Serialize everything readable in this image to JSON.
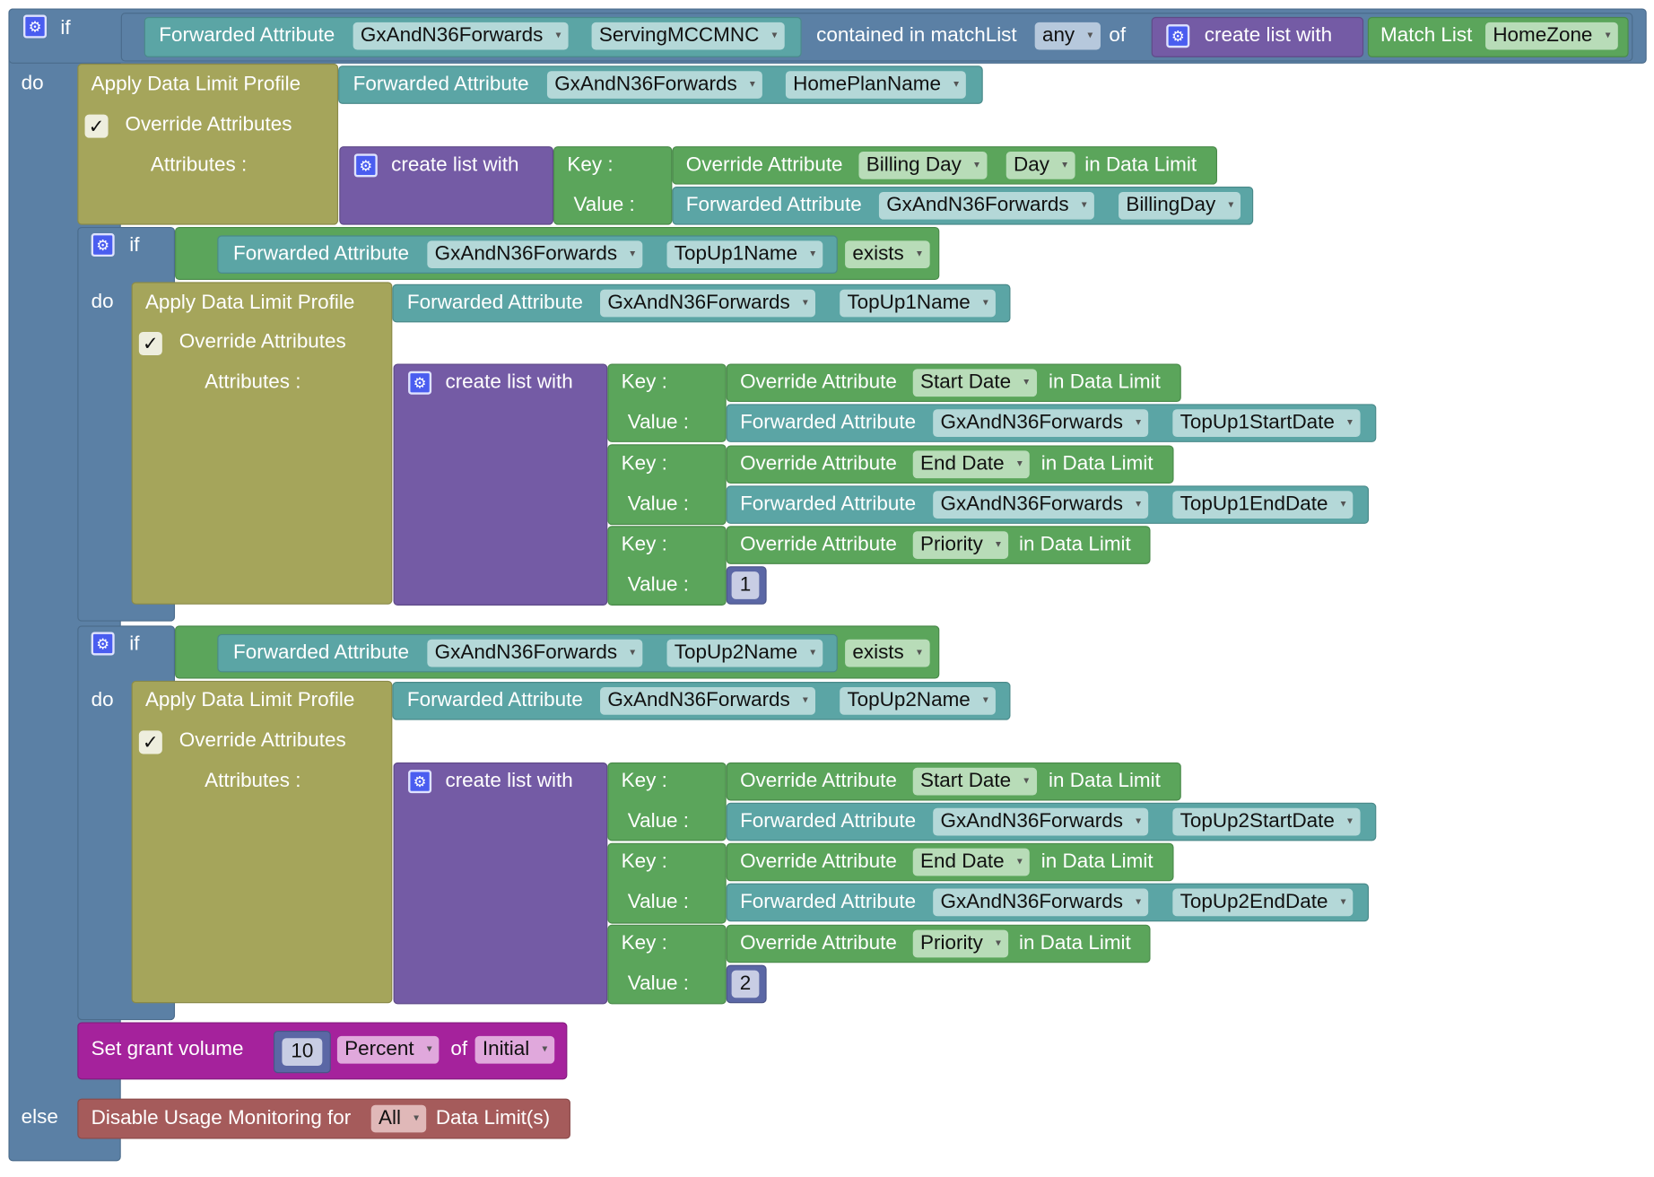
{
  "keywords": {
    "if": "if",
    "do": "do",
    "else": "else",
    "of": "of",
    "key": "Key :",
    "value": "Value :",
    "attributes": "Attributes :"
  },
  "icons": {
    "gear": "⚙",
    "check": "✓",
    "caret": "▾"
  },
  "colors": {
    "logic": "#5b80a5",
    "profile": "#a5a55b",
    "list": "#745ba5",
    "override": "#5ba55b",
    "forwarded": "#5ba5a5",
    "grant": "#a5229c",
    "disable": "#a55b5b"
  },
  "top_condition": {
    "label": "Forwarded Attribute",
    "source": "GxAndN36Forwards",
    "attr": "ServingMCCMNC",
    "contained_label": "contained in matchList",
    "mode": "any",
    "of_label": "of",
    "list_label": "create list with",
    "matchlist_label": "Match List",
    "matchlist_value": "HomeZone"
  },
  "profile_main": {
    "title": "Apply Data Limit Profile",
    "override_label": "Override Attributes",
    "profile_ref": {
      "label": "Forwarded Attribute",
      "source": "GxAndN36Forwards",
      "attr": "HomePlanName"
    },
    "list_label": "create list with",
    "pairs": [
      {
        "key": {
          "label": "Override Attribute",
          "attr": "Billing Day",
          "unit": "Day",
          "suffix": "in Data Limit"
        },
        "value": {
          "label": "Forwarded Attribute",
          "source": "GxAndN36Forwards",
          "attr": "BillingDay"
        }
      }
    ]
  },
  "topup1": {
    "cond": {
      "label": "Forwarded Attribute",
      "source": "GxAndN36Forwards",
      "attr": "TopUp1Name",
      "op": "exists"
    },
    "title": "Apply Data Limit Profile",
    "override_label": "Override Attributes",
    "profile_ref": {
      "label": "Forwarded Attribute",
      "source": "GxAndN36Forwards",
      "attr": "TopUp1Name"
    },
    "list_label": "create list with",
    "pairs": [
      {
        "key": {
          "label": "Override Attribute",
          "attr": "Start Date",
          "suffix": "in Data Limit"
        },
        "value": {
          "label": "Forwarded Attribute",
          "source": "GxAndN36Forwards",
          "attr": "TopUp1StartDate"
        }
      },
      {
        "key": {
          "label": "Override Attribute",
          "attr": "End Date",
          "suffix": "in Data Limit"
        },
        "value": {
          "label": "Forwarded Attribute",
          "source": "GxAndN36Forwards",
          "attr": "TopUp1EndDate"
        }
      },
      {
        "key": {
          "label": "Override Attribute",
          "attr": "Priority",
          "suffix": "in Data Limit"
        },
        "value": {
          "number": "1"
        }
      }
    ]
  },
  "topup2": {
    "cond": {
      "label": "Forwarded Attribute",
      "source": "GxAndN36Forwards",
      "attr": "TopUp2Name",
      "op": "exists"
    },
    "title": "Apply Data Limit Profile",
    "override_label": "Override Attributes",
    "profile_ref": {
      "label": "Forwarded Attribute",
      "source": "GxAndN36Forwards",
      "attr": "TopUp2Name"
    },
    "list_label": "create list with",
    "pairs": [
      {
        "key": {
          "label": "Override Attribute",
          "attr": "Start Date",
          "suffix": "in Data Limit"
        },
        "value": {
          "label": "Forwarded Attribute",
          "source": "GxAndN36Forwards",
          "attr": "TopUp2StartDate"
        }
      },
      {
        "key": {
          "label": "Override Attribute",
          "attr": "End Date",
          "suffix": "in Data Limit"
        },
        "value": {
          "label": "Forwarded Attribute",
          "source": "GxAndN36Forwards",
          "attr": "TopUp2EndDate"
        }
      },
      {
        "key": {
          "label": "Override Attribute",
          "attr": "Priority",
          "suffix": "in Data Limit"
        },
        "value": {
          "number": "2"
        }
      }
    ]
  },
  "grant": {
    "label": "Set grant volume",
    "value": "10",
    "unit": "Percent",
    "of_label": "of",
    "base": "Initial"
  },
  "else_action": {
    "label": "Disable Usage Monitoring for",
    "scope": "All",
    "suffix": "Data Limit(s)"
  }
}
